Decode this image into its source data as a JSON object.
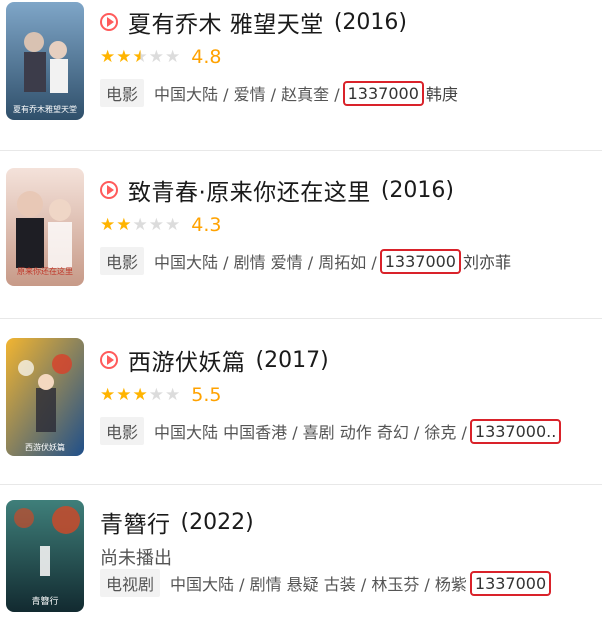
{
  "items": [
    {
      "title": "夏有乔木 雅望天堂",
      "year": "(2016)",
      "has_play": true,
      "stars": [
        "full",
        "full",
        "half",
        "empty",
        "empty"
      ],
      "score": "4.8",
      "type_label": "电影",
      "meta": "中国大陆 / 爱情 / 赵真奎 /",
      "id_value": "1337000",
      "tail": "韩庚",
      "poster_text": "夏有乔木雅望天堂",
      "poster_colors": [
        "#6a8fb3",
        "#2f4f6a"
      ]
    },
    {
      "title": "致青春·原来你还在这里",
      "year": "(2016)",
      "has_play": true,
      "stars": [
        "full",
        "full",
        "empty",
        "empty",
        "empty"
      ],
      "score": "4.3",
      "type_label": "电影",
      "meta": "中国大陆 / 剧情 爱情 / 周拓如 /",
      "id_value": "1337000",
      "tail": "刘亦菲",
      "poster_text": "原来你还在这里",
      "poster_colors": [
        "#f0d7cf",
        "#b88a7a"
      ]
    },
    {
      "title": "西游伏妖篇",
      "year": "(2017)",
      "has_play": true,
      "stars": [
        "full",
        "full",
        "full",
        "empty",
        "empty"
      ],
      "score": "5.5",
      "type_label": "电影",
      "meta": "中国大陆 中国香港 / 喜剧 动作 奇幻 / 徐克 /",
      "id_value": "1337000..",
      "tail": "",
      "poster_text": "西游伏妖篇",
      "poster_colors": [
        "#e8a21a",
        "#1f4f8a"
      ]
    },
    {
      "title": "青簪行",
      "year": "(2022)",
      "has_play": false,
      "status": "尚未播出",
      "type_label": "电视剧",
      "meta": "中国大陆 / 剧情 悬疑 古装 / 林玉芬 / 杨紫",
      "id_value": "1337000",
      "tail": "",
      "poster_text": "青簪行",
      "poster_colors": [
        "#2f6a6a",
        "#15323a"
      ]
    }
  ]
}
